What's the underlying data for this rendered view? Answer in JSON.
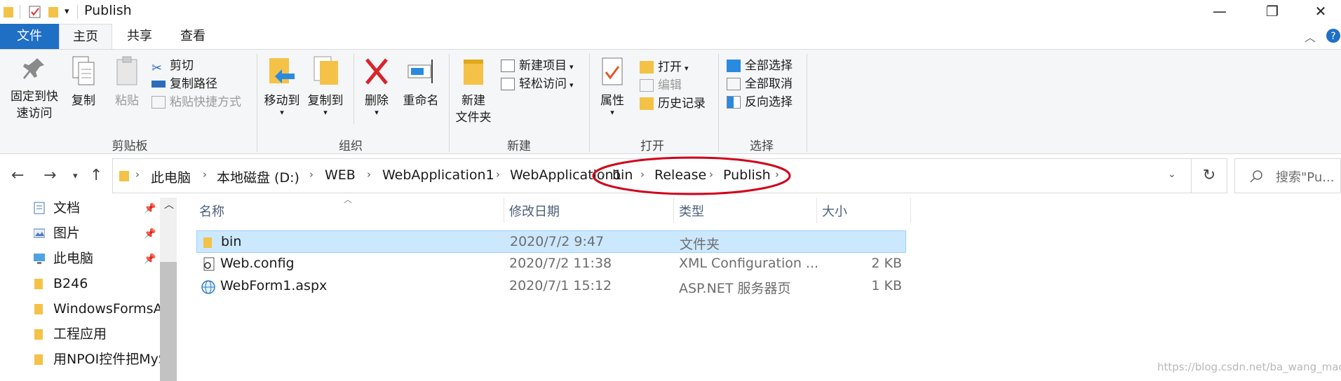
{
  "window": {
    "title": "Publish",
    "minimize": "—",
    "maximize": "❐",
    "close": "✕"
  },
  "tabs": [
    "文件",
    "主页",
    "共享",
    "查看"
  ],
  "ribbon": {
    "clipboard": {
      "pin": "固定到快\n速访问",
      "copy": "复制",
      "paste": "粘贴",
      "cut": "剪切",
      "copy_path": "复制路径",
      "paste_shortcut": "粘贴快捷方式",
      "label": "剪贴板"
    },
    "organize": {
      "move_to": "移动到",
      "copy_to": "复制到",
      "delete": "删除",
      "rename": "重命名",
      "label": "组织"
    },
    "new": {
      "new_folder": "新建\n文件夹",
      "new_item": "新建项目",
      "easy_access": "轻松访问",
      "label": "新建"
    },
    "open": {
      "properties": "属性",
      "open": "打开",
      "edit": "编辑",
      "history": "历史记录",
      "label": "打开"
    },
    "select": {
      "select_all": "全部选择",
      "select_none": "全部取消",
      "invert": "反向选择",
      "label": "选择"
    }
  },
  "address": {
    "crumbs": [
      "此电脑",
      "本地磁盘 (D:)",
      "WEB",
      "WebApplication1",
      "WebApplication1",
      "bin",
      "Release",
      "Publish"
    ],
    "search_placeholder": "搜索\"Pu..."
  },
  "nav": [
    {
      "label": "文档",
      "icon": "documents-icon",
      "pinned": true
    },
    {
      "label": "图片",
      "icon": "pictures-icon",
      "pinned": true
    },
    {
      "label": "此电脑",
      "icon": "computer-icon",
      "pinned": true
    },
    {
      "label": "B246",
      "icon": "folder-icon",
      "pinned": false
    },
    {
      "label": "WindowsFormsAp",
      "icon": "folder-icon",
      "pinned": false
    },
    {
      "label": "工程应用",
      "icon": "folder-icon",
      "pinned": false
    },
    {
      "label": "用NPOI控件把MyS",
      "icon": "folder-icon",
      "pinned": false
    }
  ],
  "columns": [
    "名称",
    "修改日期",
    "类型",
    "大小"
  ],
  "files": [
    {
      "name": "bin",
      "date": "2020/7/2 9:47",
      "type": "文件夹",
      "size": "",
      "icon": "folder-icon",
      "selected": true
    },
    {
      "name": "Web.config",
      "date": "2020/7/2 11:38",
      "type": "XML Configuration ...",
      "size": "2 KB",
      "icon": "config-file-icon",
      "selected": false
    },
    {
      "name": "WebForm1.aspx",
      "date": "2020/7/1 15:12",
      "type": "ASP.NET 服务器页",
      "size": "1 KB",
      "icon": "web-page-icon",
      "selected": false
    }
  ],
  "watermark": "https://blog.csdn.net/ba_wang_mao",
  "colors": {
    "file_tab": "#1f6fc5",
    "selection": "#cce8ff",
    "annotation": "#d0021b"
  }
}
